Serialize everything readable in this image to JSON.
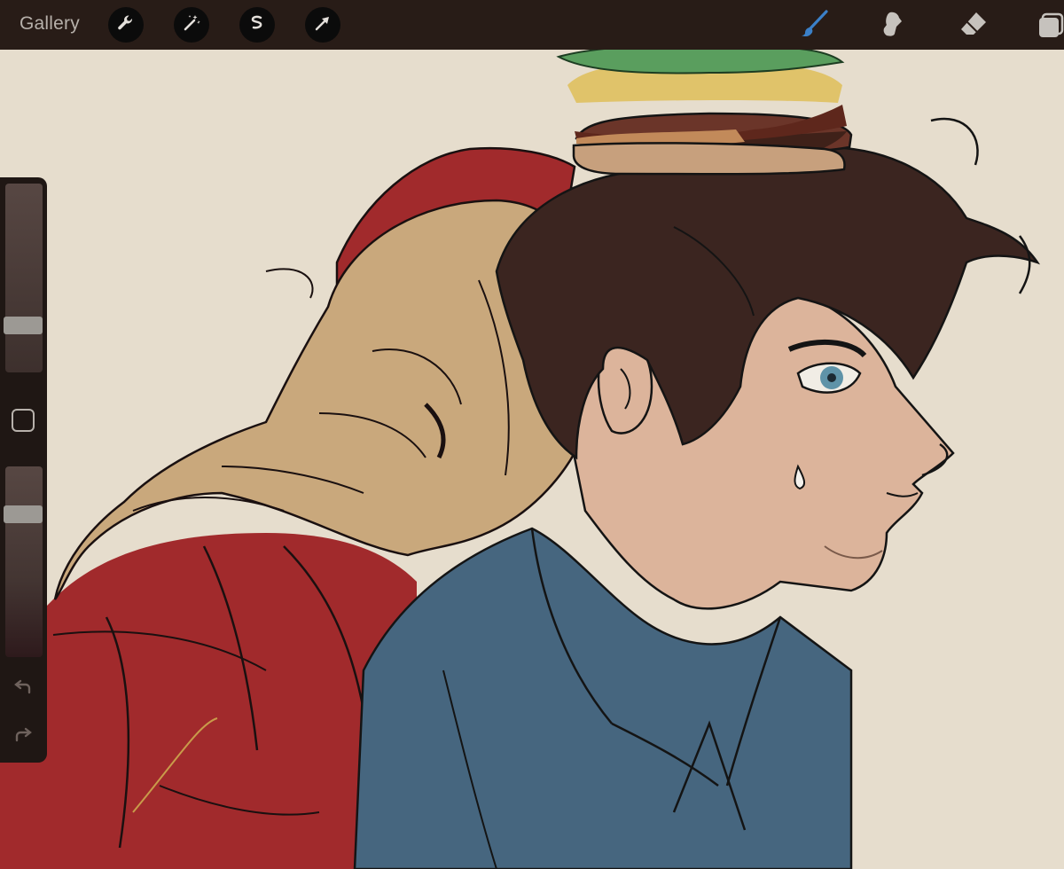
{
  "toolbar": {
    "gallery_label": "Gallery",
    "actions": [
      "wrench-icon",
      "magic-wand-icon",
      "selection-icon",
      "transform-arrow-icon"
    ],
    "paint_tools": [
      "brush-icon",
      "smudge-icon",
      "eraser-icon",
      "layers-icon"
    ],
    "active_tool": "brush-icon",
    "active_color": "#3b80c8"
  },
  "sidebar": {
    "brush_size_level": 0.26,
    "brush_opacity_level": 0.75,
    "buttons": [
      "modify-square-icon",
      "undo-icon",
      "redo-icon"
    ]
  },
  "canvas": {
    "background": "#e6ddcd",
    "palette": {
      "shirt": "#46667f",
      "hoodie": "#a12a2c",
      "blond_hair": "#c9a87c",
      "brown_hair": "#3b2520",
      "skin": "#dcb49b",
      "lettuce": "#5a9e5e",
      "bun": "#c7a07d"
    }
  }
}
